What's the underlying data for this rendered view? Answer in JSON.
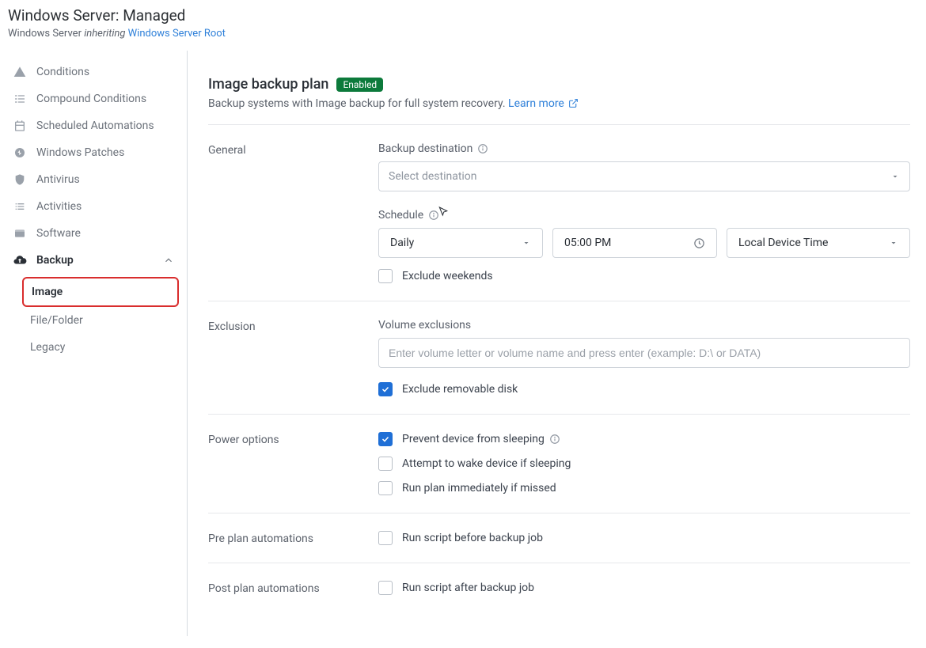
{
  "header": {
    "title": "Windows Server: Managed",
    "subtitle_prefix": "Windows Server ",
    "subtitle_italic": "inheriting ",
    "subtitle_link": "Windows Server Root"
  },
  "sidebar": {
    "items": [
      {
        "icon": "warning",
        "label": "Conditions"
      },
      {
        "icon": "compound",
        "label": "Compound Conditions"
      },
      {
        "icon": "calendar",
        "label": "Scheduled Automations"
      },
      {
        "icon": "patch",
        "label": "Windows Patches"
      },
      {
        "icon": "shield",
        "label": "Antivirus"
      },
      {
        "icon": "list",
        "label": "Activities"
      },
      {
        "icon": "window",
        "label": "Software"
      },
      {
        "icon": "cloud",
        "label": "Backup",
        "active": true,
        "expanded": true
      }
    ],
    "backup_children": [
      {
        "label": "Image",
        "selected": true
      },
      {
        "label": "File/Folder"
      },
      {
        "label": "Legacy"
      }
    ]
  },
  "plan": {
    "title": "Image backup plan",
    "badge": "Enabled",
    "description_text": "Backup systems with Image backup for full system recovery. ",
    "learn_more": "Learn more"
  },
  "sections": {
    "general": {
      "label": "General",
      "backup_destination_label": "Backup destination",
      "backup_destination_placeholder": "Select destination",
      "schedule_label": "Schedule",
      "frequency": "Daily",
      "time": "05:00 PM",
      "timezone": "Local Device Time",
      "exclude_weekends_label": "Exclude weekends",
      "exclude_weekends_checked": false
    },
    "exclusion": {
      "label": "Exclusion",
      "volume_exclusions_label": "Volume exclusions",
      "volume_exclusions_placeholder": "Enter volume letter or volume name and press enter (example: D:\\ or DATA)",
      "exclude_removable_label": "Exclude removable disk",
      "exclude_removable_checked": true
    },
    "power": {
      "label": "Power options",
      "prevent_sleep_label": "Prevent device from sleeping",
      "prevent_sleep_checked": true,
      "attempt_wake_label": "Attempt to wake device if sleeping",
      "attempt_wake_checked": false,
      "run_if_missed_label": "Run plan immediately if missed",
      "run_if_missed_checked": false
    },
    "pre_plan": {
      "label": "Pre plan automations",
      "run_before_label": "Run script before backup job",
      "run_before_checked": false
    },
    "post_plan": {
      "label": "Post plan automations",
      "run_after_label": "Run script after backup job",
      "run_after_checked": false
    }
  }
}
